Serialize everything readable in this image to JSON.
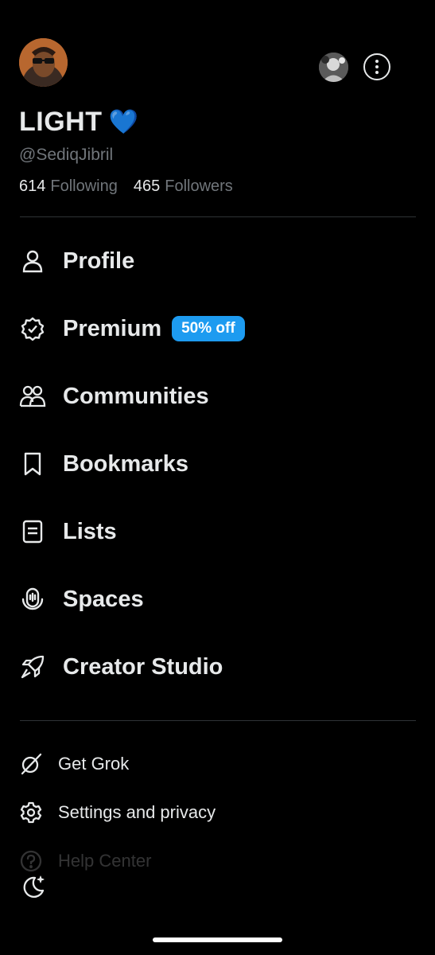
{
  "profile": {
    "display_name": "LIGHT",
    "name_emoji": "💙",
    "handle": "@SediqJibril",
    "following_count": "614",
    "following_label": "Following",
    "followers_count": "465",
    "followers_label": "Followers"
  },
  "nav": {
    "items": [
      {
        "label": "Profile",
        "icon": "person-icon"
      },
      {
        "label": "Premium",
        "icon": "verified-badge-icon",
        "badge": "50% off"
      },
      {
        "label": "Communities",
        "icon": "communities-icon"
      },
      {
        "label": "Bookmarks",
        "icon": "bookmark-icon"
      },
      {
        "label": "Lists",
        "icon": "list-icon"
      },
      {
        "label": "Spaces",
        "icon": "spaces-icon"
      },
      {
        "label": "Creator Studio",
        "icon": "rocket-icon"
      }
    ]
  },
  "secondary": {
    "items": [
      {
        "label": "Get Grok",
        "icon": "grok-icon"
      },
      {
        "label": "Settings and privacy",
        "icon": "gear-icon"
      },
      {
        "label": "Help Center",
        "icon": "help-icon"
      }
    ]
  },
  "colors": {
    "background": "#000000",
    "text_primary": "#e7e9ea",
    "text_secondary": "#71767b",
    "accent": "#1d9bf0",
    "divider": "#2f3336"
  }
}
